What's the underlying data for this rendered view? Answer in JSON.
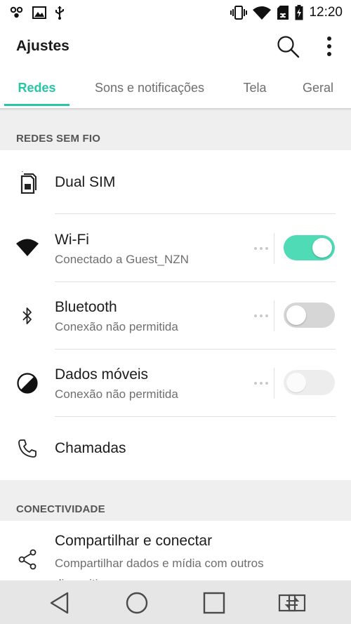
{
  "status_bar": {
    "time": "12:20",
    "left_icons": [
      "notification-app-icon",
      "image-icon",
      "usb-icon"
    ],
    "right_icons": [
      "vibrate-icon",
      "wifi-signal-icon",
      "sd-card-icon",
      "battery-charging-icon"
    ]
  },
  "app_bar": {
    "title": "Ajustes",
    "search_icon": "search-icon",
    "more_icon": "more-vert-icon"
  },
  "tabs": [
    {
      "label": "Redes",
      "active": true
    },
    {
      "label": "Sons e notificações",
      "active": false
    },
    {
      "label": "Tela",
      "active": false
    },
    {
      "label": "Geral",
      "active": false
    }
  ],
  "sections": {
    "wireless": {
      "header": "REDES SEM FIO",
      "items": {
        "dual_sim": {
          "title": "Dual SIM",
          "icon": "sim-card-icon"
        },
        "wifi": {
          "title": "Wi-Fi",
          "subtitle": "Conectado a Guest_NZN",
          "icon": "wifi-icon",
          "toggle": "on"
        },
        "bluetooth": {
          "title": "Bluetooth",
          "subtitle": "Conexão não permitida",
          "icon": "bluetooth-icon",
          "toggle": "off"
        },
        "mobile_data": {
          "title": "Dados móveis",
          "subtitle": "Conexão não permitida",
          "icon": "mobile-data-icon",
          "toggle": "disabled"
        },
        "calls": {
          "title": "Chamadas",
          "icon": "phone-icon"
        }
      }
    },
    "connectivity": {
      "header": "CONECTIVIDADE",
      "items": {
        "share": {
          "title": "Compartilhar e conectar",
          "subtitle": "Compartilhar dados e mídia com outros dispositivos",
          "icon": "share-icon"
        }
      }
    }
  },
  "nav_bar": {
    "back": "back-icon",
    "home": "home-icon",
    "recents": "recents-icon",
    "dual_window": "dual-window-icon"
  },
  "colors": {
    "accent": "#26c6a6",
    "toggle_on": "#4fdbb5",
    "section_bg": "#efefef",
    "nav_bg": "#e6e6e6"
  }
}
